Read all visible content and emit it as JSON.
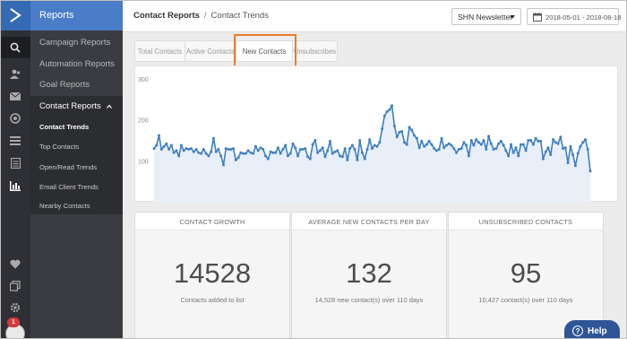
{
  "nav": {
    "header": "Reports",
    "items": [
      {
        "label": "Campaign Reports"
      },
      {
        "label": "Automation Reports"
      },
      {
        "label": "Goal Reports"
      }
    ],
    "group": {
      "label": "Contact Reports",
      "subitems": [
        {
          "label": "Contact Trends",
          "active": true
        },
        {
          "label": "Top Contacts"
        },
        {
          "label": "Open/Read Trends"
        },
        {
          "label": "Email Client Trends"
        },
        {
          "label": "Nearby Contacts"
        }
      ]
    }
  },
  "rail": {
    "icons": [
      "logo-arrow-icon",
      "search-icon",
      "contacts-icon",
      "mail-icon",
      "target-icon",
      "list-icon",
      "document-icon",
      "bar-chart-icon",
      "heart-icon",
      "copy-icon",
      "gear-icon"
    ],
    "notification_count": "1"
  },
  "header": {
    "breadcrumb_root": "Contact Reports",
    "breadcrumb_sep": "/",
    "breadcrumb_current": "Contact Trends",
    "list_select": "SHN Newsletter",
    "date_range": "2018-05-01 - 2018-08-18"
  },
  "tabs": [
    {
      "label": "Total Contacts"
    },
    {
      "label": "Active Contacts"
    },
    {
      "label": "New Contacts",
      "active": true
    },
    {
      "label": "Unsubscribes"
    }
  ],
  "chart_data": {
    "type": "area",
    "ylim": [
      0,
      300
    ],
    "y_ticks": [
      "300",
      "200",
      "100"
    ],
    "grid": false,
    "legend": "none",
    "color": "#3f7fc2",
    "fill": "#e8eff9",
    "values": [
      130,
      138,
      162,
      128,
      135,
      142,
      128,
      138,
      120,
      125,
      112,
      138,
      125,
      130,
      128,
      130,
      122,
      128,
      120,
      118,
      128,
      118,
      112,
      122,
      155,
      122,
      128,
      112,
      90,
      130,
      128,
      128,
      130,
      102,
      108,
      120,
      118,
      118,
      125,
      120,
      118,
      135,
      125,
      132,
      128,
      112,
      105,
      122,
      120,
      120,
      132,
      118,
      128,
      138,
      112,
      118,
      142,
      132,
      112,
      128,
      128,
      130,
      110,
      105,
      140,
      150,
      120,
      125,
      132,
      110,
      125,
      148,
      118,
      122,
      125,
      112,
      110,
      130,
      102,
      130,
      138,
      128,
      102,
      150,
      120,
      105,
      128,
      152,
      130,
      138,
      135,
      145,
      178,
      210,
      220,
      225,
      235,
      185,
      158,
      170,
      172,
      145,
      140,
      182,
      175,
      162,
      155,
      132,
      148,
      135,
      140,
      148,
      140,
      130,
      125,
      128,
      155,
      132,
      138,
      142,
      138,
      130,
      120,
      128,
      130,
      145,
      138,
      112,
      150,
      138,
      152,
      145,
      140,
      150,
      128,
      160,
      142,
      128,
      130,
      142,
      148,
      138,
      125,
      112,
      140,
      120,
      132,
      112,
      140,
      140,
      125,
      150,
      150,
      140,
      155,
      148,
      148,
      105,
      122,
      132,
      115,
      152,
      145,
      142,
      158,
      130,
      132,
      95,
      135,
      115,
      88,
      118,
      135,
      145,
      152,
      128,
      75
    ]
  },
  "cards": [
    {
      "title": "CONTACT GROWTH",
      "value": "14528",
      "sub": "Contacts added to list"
    },
    {
      "title": "AVERAGE NEW CONTACTS PER DAY",
      "value": "132",
      "sub": "14,528 new contact(s) over 110 days"
    },
    {
      "title": "UNSUBSCRIBED CONTACTS",
      "value": "95",
      "sub": "10,427 contact(s) over 110 days"
    }
  ],
  "help_label": "Help",
  "colors": {
    "accent": "#4a7cc7",
    "highlight": "#e87c2c",
    "line": "#3f7fc2"
  }
}
